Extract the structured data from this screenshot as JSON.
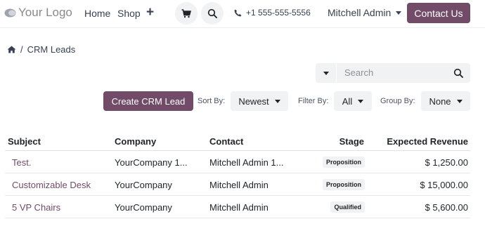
{
  "nav": {
    "logo_text": "Your Logo",
    "links": [
      "Home",
      "Shop"
    ],
    "plus": "+",
    "phone": "+1 555-555-5556",
    "user": "Mitchell Admin",
    "contact_label": "Contact Us",
    "icons": [
      "cart-icon",
      "search-icon",
      "phone-icon"
    ]
  },
  "breadcrumb": {
    "separator": "/",
    "current": "CRM Leads"
  },
  "search": {
    "placeholder": "Search"
  },
  "toolbar": {
    "create_label": "Create CRM Lead",
    "sort_label": "Sort By:",
    "sort_value": "Newest",
    "filter_label": "Filter By:",
    "filter_value": "All",
    "group_label": "Group By:",
    "group_value": "None"
  },
  "table": {
    "headers": [
      "Subject",
      "Company",
      "Contact",
      "Stage",
      "Expected Revenue"
    ],
    "rows": [
      [
        "Test.",
        "YourCompany 1...",
        "Mitchell Admin 1...",
        "Proposition",
        "$ 1,250.00"
      ],
      [
        "Customizable Desk",
        "YourCompany",
        "Mitchell Admin",
        "Proposition",
        "$ 15,000.00"
      ],
      [
        "5 VP Chairs",
        "YourCompany",
        "Mitchell Admin",
        "Qualified",
        "$ 5,600.00"
      ]
    ]
  },
  "colors": {
    "brand": "#714b67",
    "button_bg": "#f1f2f4",
    "text": "#212529"
  }
}
